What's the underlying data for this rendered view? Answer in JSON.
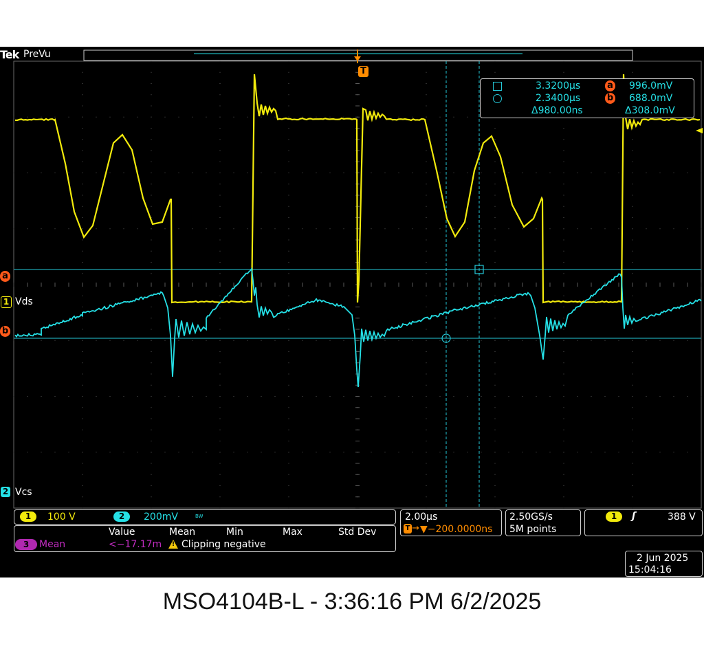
{
  "header": {
    "brand": "Tek",
    "mode": "PreVu"
  },
  "markers": {
    "trigger": "T",
    "cursor_a": "a",
    "cursor_b": "b",
    "ch1": "1",
    "ch2": "2",
    "math": "3"
  },
  "channels": {
    "ch1": {
      "name": "Vds",
      "scale": "100 V",
      "color": "#f2ea0c"
    },
    "ch2": {
      "name": "Vcs",
      "scale": "200mV",
      "bw_icon": "BW",
      "color": "#25e0e6"
    }
  },
  "cursor_readout": {
    "t1": "3.3200µs",
    "v_a": "996.0mV",
    "t2": "2.3400µs",
    "v_b": "688.0mV",
    "dt": "Δ980.00ns",
    "dv": "Δ308.0mV"
  },
  "measurement": {
    "headers": [
      "Value",
      "Mean",
      "Min",
      "Max",
      "Std Dev"
    ],
    "label": "Mean",
    "value": "<−17.17m",
    "warning": "Clipping negative",
    "warning_icon": "warning-icon"
  },
  "timebase": {
    "scale": "2.00µs",
    "delay": "▼−200.0000ns"
  },
  "acquisition": {
    "rate": "2.50GS/s",
    "points": "5M points"
  },
  "trigger": {
    "source": "1",
    "slope_icon": "rising-edge-icon",
    "level": "388 V"
  },
  "datetime": {
    "date": "2 Jun 2025",
    "time": "15:04:16"
  },
  "caption": "MSO4104B-L - 3:36:16 PM    6/2/2025"
}
